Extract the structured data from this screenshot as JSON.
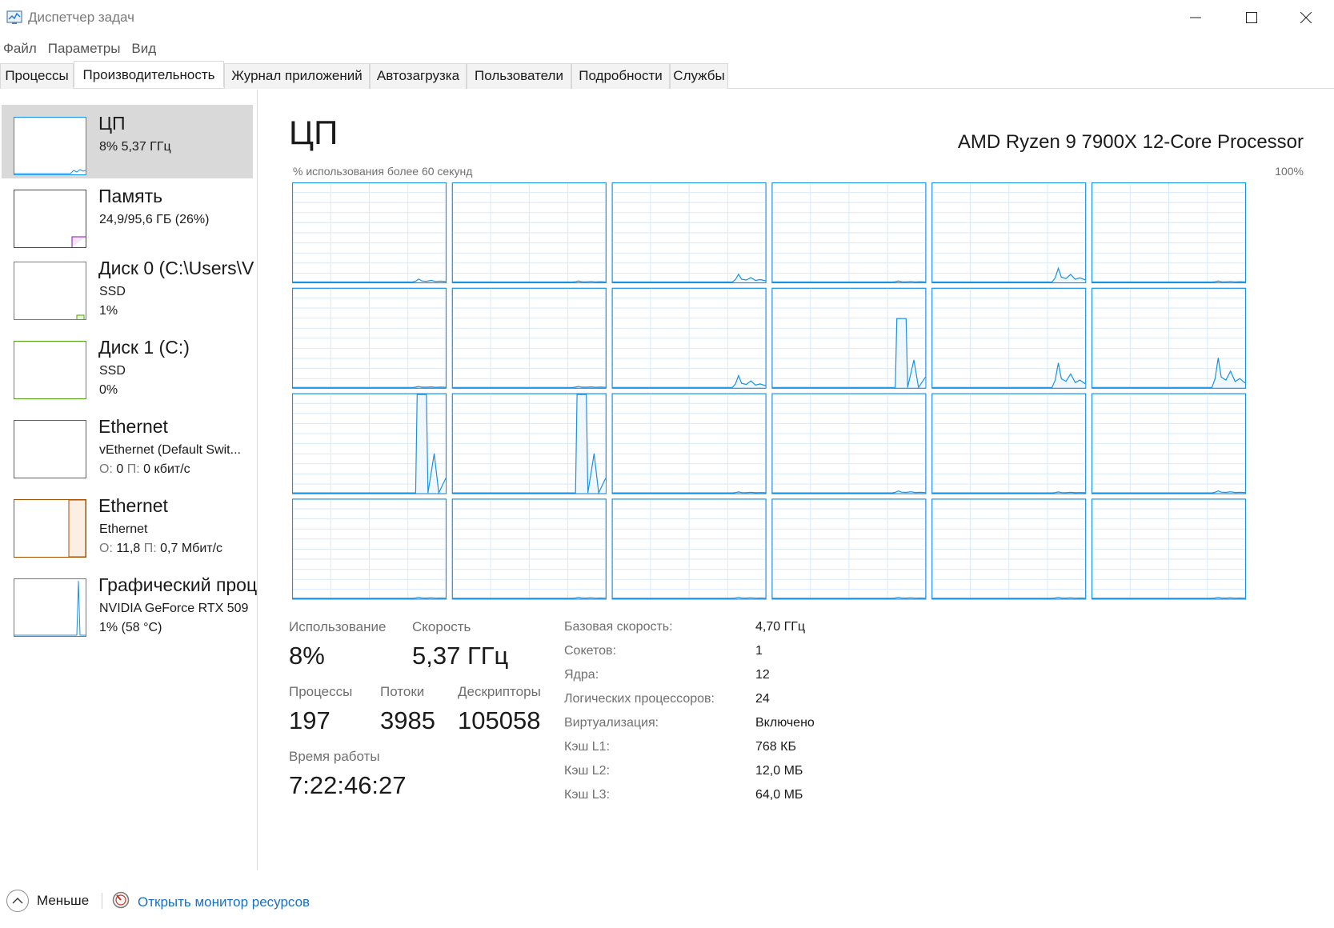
{
  "window": {
    "title": "Диспетчер задач"
  },
  "menu": [
    "Файл",
    "Параметры",
    "Вид"
  ],
  "tabs": [
    "Процессы",
    "Производительность",
    "Журнал приложений",
    "Автозагрузка",
    "Пользователи",
    "Подробности",
    "Службы"
  ],
  "active_tab": "Производительность",
  "sidebar": {
    "items": [
      {
        "title": "ЦП",
        "line1": "8%  5,37 ГГц",
        "line2": "",
        "color": "#1792e5",
        "selected": true
      },
      {
        "title": "Память",
        "line1": "24,9/95,6 ГБ (26%)",
        "line2": "",
        "color": "#8b12ae",
        "selected": false
      },
      {
        "title": "Диск 0 (C:\\Users\\V",
        "line1": "SSD",
        "line2": "1%",
        "color": "#4da60c",
        "selected": false
      },
      {
        "title": "Диск 1 (C:)",
        "line1": "SSD",
        "line2": "0%",
        "color": "#4da60c",
        "selected": false
      },
      {
        "title": "Ethernet",
        "line1": "vEthernet (Default Swit...",
        "send_label": "О:",
        "send_value": "0",
        "recv_label": "П:",
        "recv_value": "0 кбит/с",
        "color": "#a74f01",
        "selected": false
      },
      {
        "title": "Ethernet",
        "line1": "Ethernet",
        "send_label": "О:",
        "send_value": "11,8",
        "recv_label": "П:",
        "recv_value": "0,7 Мбит/с",
        "color": "#a74f01",
        "selected": false
      },
      {
        "title": "Графический проц",
        "line1": "NVIDIA GeForce RTX 509",
        "line2": "1%  (58 °C)",
        "color": "#1792e5",
        "selected": false
      }
    ]
  },
  "main": {
    "title": "ЦП",
    "model": "AMD Ryzen 9 7900X 12-Core Processor",
    "graph_caption": "% использования более 60 секунд",
    "graph_max": "100%",
    "logical_cpu_usage_peaks": [
      3,
      1,
      8,
      1,
      14,
      1,
      1,
      1,
      12,
      70,
      25,
      30,
      100,
      100,
      1,
      2,
      1,
      2,
      1,
      1,
      1,
      1,
      1,
      1
    ],
    "stats": {
      "usage_label": "Использование",
      "usage_value": "8%",
      "speed_label": "Скорость",
      "speed_value": "5,37 ГГц",
      "processes_label": "Процессы",
      "processes_value": "197",
      "threads_label": "Потоки",
      "threads_value": "3985",
      "handles_label": "Дескрипторы",
      "handles_value": "105058",
      "uptime_label": "Время работы",
      "uptime_value": "7:22:46:27"
    },
    "details": [
      {
        "key": "Базовая скорость:",
        "value": "4,70 ГГц"
      },
      {
        "key": "Сокетов:",
        "value": "1"
      },
      {
        "key": "Ядра:",
        "value": "12"
      },
      {
        "key": "Логических процессоров:",
        "value": "24"
      },
      {
        "key": "Виртуализация:",
        "value": "Включено"
      },
      {
        "key": "Кэш L1:",
        "value": "768 КБ"
      },
      {
        "key": "Кэш L2:",
        "value": "12,0 МБ"
      },
      {
        "key": "Кэш L3:",
        "value": "64,0 МБ"
      }
    ]
  },
  "footer": {
    "fewer_label": "Меньше",
    "resmon_label": "Открыть монитор ресурсов"
  },
  "colors": {
    "cpu": "#1792e5",
    "memory": "#8b12ae",
    "disk": "#4da60c",
    "ethernet": "#a74f01",
    "link": "#1a6fc4"
  }
}
